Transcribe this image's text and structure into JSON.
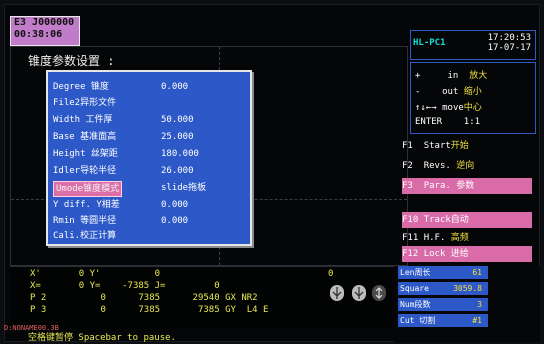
{
  "status": {
    "line1": "E3  J000000",
    "line2": "00:38:06"
  },
  "view": {
    "heading": "锥度参数设置 :"
  },
  "dialog": {
    "rows": [
      {
        "label": "Degree  锥度",
        "value": "0.000"
      },
      {
        "label": "File2异形文件",
        "value": ""
      },
      {
        "label": "Width  工件厚",
        "value": "50.000"
      },
      {
        "label": "Base 基准面高",
        "value": "25.000"
      },
      {
        "label": "Height 丝架距",
        "value": "180.000"
      },
      {
        "label": "Idler导轮半径",
        "value": "26.000"
      },
      {
        "label": "Umode锥度模式",
        "value": "slide拖板"
      },
      {
        "label": "Y diff. Y相差",
        "value": "0.000"
      },
      {
        "label": "Rmin 等圆半径",
        "value": "0.000"
      },
      {
        "label": "Cali.校正计算",
        "value": ""
      }
    ],
    "selected_index": 6
  },
  "right": {
    "label": "HL-PC1",
    "time": "17:20:53",
    "date": "17-07-17",
    "zoom": {
      "in_key": "+",
      "in_label": "in",
      "in_cn": "放大",
      "out_key": "-",
      "out_label": "out",
      "out_cn": "缩小",
      "move_key": "↑↓←→",
      "move_label": "move",
      "move_cn": "中心",
      "enter_key": "ENTER",
      "enter_val": "1:1"
    },
    "fkeys": [
      {
        "key": "F1",
        "label": "Start",
        "cn": "开始",
        "pink": false
      },
      {
        "key": "F2",
        "label": "Revs.",
        "cn": "逆向",
        "pink": false
      },
      {
        "key": "F3",
        "label": "Para.",
        "cn": "参数",
        "pink": true
      },
      {
        "key": "F10",
        "label": "Track",
        "cn": "自动",
        "pink": true
      },
      {
        "key": "F11",
        "label": "H.F.",
        "cn": "高频",
        "pink": false
      },
      {
        "key": "F12",
        "label": "Lock",
        "cn": "进给",
        "pink": true
      }
    ]
  },
  "coords": {
    "line1": "X'       0 Y'          0                               0",
    "line2": "X=       0 Y=    -7385 J=         0",
    "line3": "P 2          0      7385      29540 GX NR2",
    "line4": "P 3          0      7385       7385 GY  L4 E"
  },
  "pause": "空格键暂停 Spacebar to pause.",
  "stats": [
    {
      "label": "Len周长",
      "value": "61"
    },
    {
      "label": "Square",
      "value": "3059.8"
    },
    {
      "label": "Num段数",
      "value": "3"
    },
    {
      "label": "Cut 切割",
      "value": "#1"
    }
  ],
  "file": "D:NONAME00.3B"
}
